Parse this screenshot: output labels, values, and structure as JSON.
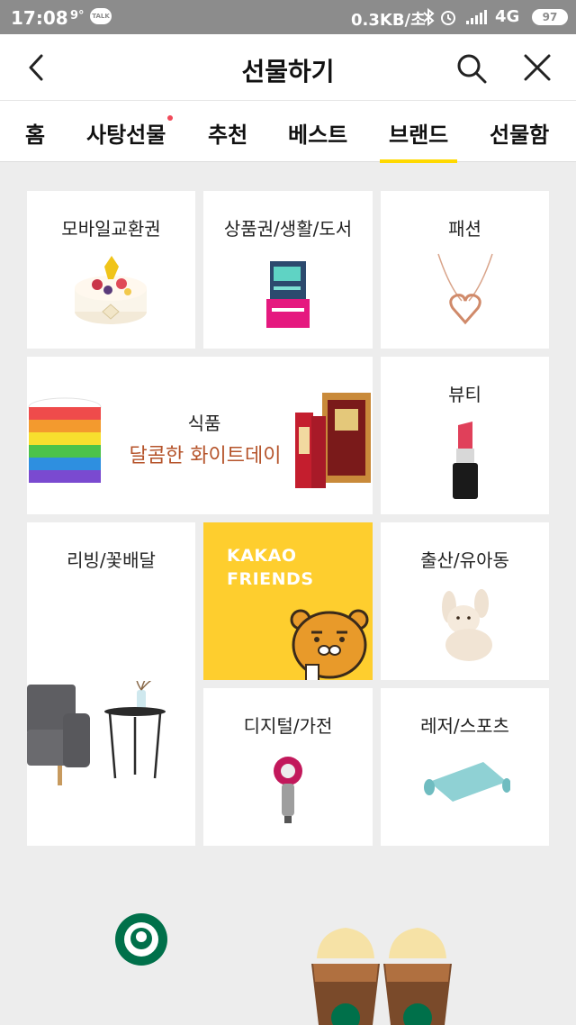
{
  "status_bar": {
    "time": "17:08",
    "temperature": "9°",
    "talk_badge": "TALK",
    "network_speed": "0.3KB/초",
    "network_type": "4G",
    "battery": "97"
  },
  "header": {
    "title": "선물하기",
    "icons": [
      "back-arrow-icon",
      "search-icon",
      "close-icon"
    ]
  },
  "tabs": [
    {
      "label": "홈",
      "active": false,
      "has_dot": false
    },
    {
      "label": "사탕선물",
      "active": false,
      "has_dot": true
    },
    {
      "label": "추천",
      "active": false,
      "has_dot": false
    },
    {
      "label": "베스트",
      "active": false,
      "has_dot": false
    },
    {
      "label": "브랜드",
      "active": true,
      "has_dot": false
    },
    {
      "label": "선물함",
      "active": false,
      "has_dot": false
    }
  ],
  "categories": {
    "mobile_voucher": "모바일교환권",
    "giftcard_living_books": "상품권/생활/도서",
    "fashion": "패션",
    "food": "식품",
    "food_promo": "달콤한 화이트데이",
    "beauty": "뷰티",
    "living_flowers": "리빙/꽃배달",
    "kakao_friends_line1": "KAKAO",
    "kakao_friends_line2": "FRIENDS",
    "baby_kids": "출산/유아동",
    "digital_appliances": "디지털/가전",
    "leisure_sports": "레저/스포츠"
  },
  "colors": {
    "accent": "#ffd900",
    "kakao_yellow": "#fece2e",
    "promo_text": "#b5532a",
    "notification_dot": "#f14a5a",
    "background": "#ededed"
  }
}
